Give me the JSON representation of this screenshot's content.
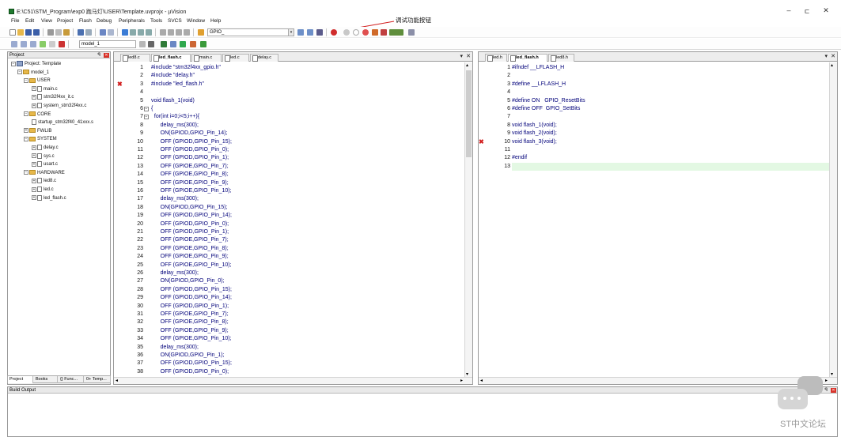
{
  "window": {
    "title": "E:\\C51\\STM_Program\\exp0 跑马灯\\USER\\Template.uvprojx - µVision",
    "minimize": "–",
    "restore": "ㄷ",
    "close": "✕"
  },
  "menu": [
    "File",
    "Edit",
    "View",
    "Project",
    "Flash",
    "Debug",
    "Peripherals",
    "Tools",
    "SVCS",
    "Window",
    "Help"
  ],
  "toolbar": {
    "find_value": "GPIO_",
    "target_value": "model_1"
  },
  "annotation": "调试功能按钮",
  "project_panel": {
    "title": "Project",
    "pin": "ꟼ",
    "close": "✕",
    "tree": [
      {
        "label": "Project: Template",
        "level": 0,
        "kind": "project",
        "exp": "⊟"
      },
      {
        "label": "model_1",
        "level": 1,
        "kind": "folder",
        "exp": "⊟"
      },
      {
        "label": "USER",
        "level": 2,
        "kind": "folder",
        "exp": "⊟"
      },
      {
        "label": "main.c",
        "level": 3,
        "kind": "file",
        "exp": "⊞"
      },
      {
        "label": "stm32f4xx_it.c",
        "level": 3,
        "kind": "file",
        "exp": "⊞"
      },
      {
        "label": "system_stm32f4xx.c",
        "level": 3,
        "kind": "file",
        "exp": "⊞"
      },
      {
        "label": "CORE",
        "level": 2,
        "kind": "folder",
        "exp": "⊟"
      },
      {
        "label": "startup_stm32f40_41xxx.s",
        "level": 3,
        "kind": "file",
        "exp": ""
      },
      {
        "label": "FWLIB",
        "level": 2,
        "kind": "folder",
        "exp": "⊞"
      },
      {
        "label": "SYSTEM",
        "level": 2,
        "kind": "folder",
        "exp": "⊟"
      },
      {
        "label": "delay.c",
        "level": 3,
        "kind": "file",
        "exp": "⊞"
      },
      {
        "label": "sys.c",
        "level": 3,
        "kind": "file",
        "exp": "⊞"
      },
      {
        "label": "usart.c",
        "level": 3,
        "kind": "file",
        "exp": "⊞"
      },
      {
        "label": "HARDWARE",
        "level": 2,
        "kind": "folder",
        "exp": "⊟"
      },
      {
        "label": "led8.c",
        "level": 3,
        "kind": "file",
        "exp": "⊞"
      },
      {
        "label": "led.c",
        "level": 3,
        "kind": "file",
        "exp": "⊞"
      },
      {
        "label": "led_flash.c",
        "level": 3,
        "kind": "file",
        "exp": "⊞"
      }
    ],
    "tabs": [
      "Project",
      "Books",
      "{} Func...",
      "0+ Temp..."
    ]
  },
  "editor_left": {
    "tabs": [
      "led8.c",
      "led_flash.c",
      "main.c",
      "led.c",
      "delay.c"
    ],
    "active_tab": 1,
    "tab_menu": "▾",
    "tab_close": "✕",
    "lines": [
      {
        "n": "1",
        "t": "#include \"stm32f4xx_gpio.h\"",
        "k": "inc"
      },
      {
        "n": "2",
        "t": "#include \"delay.h\"",
        "k": "inc"
      },
      {
        "n": "3",
        "t": "#include \"led_flash.h\"",
        "k": "inc",
        "err": true
      },
      {
        "n": "4",
        "t": ""
      },
      {
        "n": "5",
        "t": "void flash_1(void)"
      },
      {
        "n": "6",
        "t": "{",
        "fold": "⊟"
      },
      {
        "n": "7",
        "t": "  for(int i=0;i<5;i++){",
        "fold": "⊟"
      },
      {
        "n": "8",
        "t": "      delay_ms(300);"
      },
      {
        "n": "9",
        "t": "      ON(GPIOD,GPIO_Pin_14);"
      },
      {
        "n": "10",
        "t": "      OFF (GPIOD,GPIO_Pin_15);"
      },
      {
        "n": "11",
        "t": "      OFF (GPIOD,GPIO_Pin_0);"
      },
      {
        "n": "12",
        "t": "      OFF (GPIOD,GPIO_Pin_1);"
      },
      {
        "n": "13",
        "t": "      OFF (GPIOE,GPIO_Pin_7);"
      },
      {
        "n": "14",
        "t": "      OFF (GPIOE,GPIO_Pin_8);"
      },
      {
        "n": "15",
        "t": "      OFF (GPIOE,GPIO_Pin_9);"
      },
      {
        "n": "16",
        "t": "      OFF (GPIOE,GPIO_Pin_10);"
      },
      {
        "n": "17",
        "t": "      delay_ms(300);"
      },
      {
        "n": "18",
        "t": "      ON(GPIOD,GPIO_Pin_15);"
      },
      {
        "n": "19",
        "t": "      OFF (GPIOD,GPIO_Pin_14);"
      },
      {
        "n": "20",
        "t": "      OFF (GPIOD,GPIO_Pin_0);"
      },
      {
        "n": "21",
        "t": "      OFF (GPIOD,GPIO_Pin_1);"
      },
      {
        "n": "22",
        "t": "      OFF (GPIOE,GPIO_Pin_7);"
      },
      {
        "n": "23",
        "t": "      OFF (GPIOE,GPIO_Pin_8);"
      },
      {
        "n": "24",
        "t": "      OFF (GPIOE,GPIO_Pin_9);"
      },
      {
        "n": "25",
        "t": "      OFF (GPIOE,GPIO_Pin_10);"
      },
      {
        "n": "26",
        "t": "      delay_ms(300);"
      },
      {
        "n": "27",
        "t": "      ON(GPIOD,GPIO_Pin_0);"
      },
      {
        "n": "28",
        "t": "      OFF (GPIOD,GPIO_Pin_15);"
      },
      {
        "n": "29",
        "t": "      OFF (GPIOD,GPIO_Pin_14);"
      },
      {
        "n": "30",
        "t": "      OFF (GPIOD,GPIO_Pin_1);"
      },
      {
        "n": "31",
        "t": "      OFF (GPIOE,GPIO_Pin_7);"
      },
      {
        "n": "32",
        "t": "      OFF (GPIOE,GPIO_Pin_8);"
      },
      {
        "n": "33",
        "t": "      OFF (GPIOE,GPIO_Pin_9);"
      },
      {
        "n": "34",
        "t": "      OFF (GPIOE,GPIO_Pin_10);"
      },
      {
        "n": "35",
        "t": "      delay_ms(300);"
      },
      {
        "n": "36",
        "t": "      ON(GPIOD,GPIO_Pin_1);"
      },
      {
        "n": "37",
        "t": "      OFF (GPIOD,GPIO_Pin_15);"
      },
      {
        "n": "38",
        "t": "      OFF (GPIOD,GPIO_Pin_0);"
      }
    ]
  },
  "editor_right": {
    "tabs": [
      "led.h",
      "led_flash.h",
      "led8.h"
    ],
    "active_tab": 1,
    "tab_menu": "▾",
    "tab_close": "✕",
    "highlight_line": 13,
    "lines": [
      {
        "n": "1",
        "t": "#ifndef __LFLASH_H",
        "k": "pp"
      },
      {
        "n": "2",
        "t": ""
      },
      {
        "n": "3",
        "t": "#define __LFLASH_H",
        "k": "pp"
      },
      {
        "n": "4",
        "t": ""
      },
      {
        "n": "5",
        "t": "#define ON   GPIO_ResetBits",
        "k": "pp"
      },
      {
        "n": "6",
        "t": "#define OFF  GPIO_SetBits",
        "k": "pp"
      },
      {
        "n": "7",
        "t": ""
      },
      {
        "n": "8",
        "t": "void flash_1(void);"
      },
      {
        "n": "9",
        "t": "void flash_2(void);"
      },
      {
        "n": "10",
        "t": "void flash_3(void);",
        "err": true
      },
      {
        "n": "11",
        "t": ""
      },
      {
        "n": "12",
        "t": "#endif",
        "k": "pp"
      },
      {
        "n": "13",
        "t": ""
      }
    ]
  },
  "build_output": {
    "title": "Build Output",
    "pin": "ꟼ",
    "close": "✕"
  },
  "watermark": "ST中文论坛",
  "colors": {
    "error_marker": "#d21f1f",
    "code_text": "#00007a",
    "current_line": "#e3f8e3"
  }
}
